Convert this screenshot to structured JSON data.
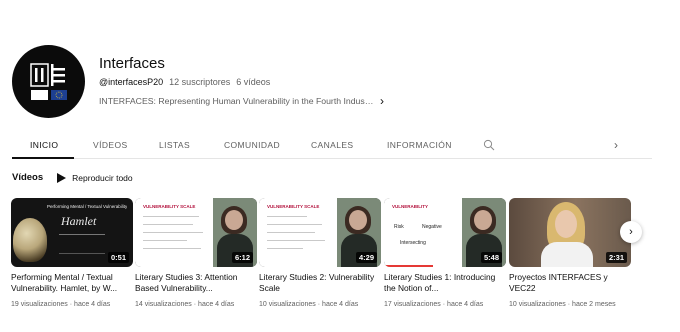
{
  "channel": {
    "name": "Interfaces",
    "handle": "@interfacesP20",
    "subscribers": "12 suscriptores",
    "videos_count": "6 vídeos",
    "description": "INTERFACES: Representing Human Vulnerability in the Fourth Industrial Re..."
  },
  "tabs": [
    {
      "label": "INICIO",
      "active": true
    },
    {
      "label": "VÍDEOS"
    },
    {
      "label": "LISTAS"
    },
    {
      "label": "COMUNIDAD"
    },
    {
      "label": "CANALES"
    },
    {
      "label": "INFORMACIÓN"
    }
  ],
  "section": {
    "title": "Vídeos",
    "play_all": "Reproducir todo"
  },
  "videos": [
    {
      "title": "Performing Mental / Textual Vulnerability. Hamlet, by W...",
      "views": "19 visualizaciones",
      "age": "hace 4 días",
      "duration": "0:51"
    },
    {
      "title": "Literary Studies 3: Attention Based Vulnerability...",
      "views": "14 visualizaciones",
      "age": "hace 4 días",
      "duration": "6:12"
    },
    {
      "title": "Literary Studies 2: Vulnerability Scale",
      "views": "10 visualizaciones",
      "age": "hace 4 días",
      "duration": "4:29"
    },
    {
      "title": "Literary Studies 1: Introducing the Notion of...",
      "views": "17 visualizaciones",
      "age": "hace 4 días",
      "duration": "5:48"
    },
    {
      "title": "Proyectos INTERFACES y VEC22",
      "views": "10 visualizaciones",
      "age": "hace 2 meses",
      "duration": "2:31"
    }
  ],
  "thumb_text": {
    "hamlet_header": "Performing Mental / Textual Vulnerability",
    "hamlet_title": "Hamlet",
    "slide_heading": "VULNERABILITY SCALE",
    "slide_heading_2": "VULNERABILITY",
    "slide_words": [
      "Risk",
      "Negative",
      "Intersecting"
    ]
  },
  "colors": {
    "accent": "#0f0f0f",
    "secondary_text": "#606060",
    "slide_red": "#b3123d"
  }
}
